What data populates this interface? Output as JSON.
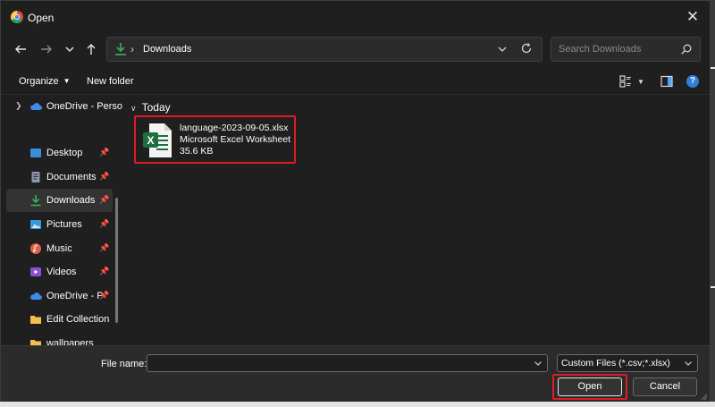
{
  "window": {
    "title": "Open",
    "close_glyph": "✕"
  },
  "nav_buttons": [
    "back-arrow-icon",
    "forward-arrow-icon",
    "recent-chevron-icon",
    "up-arrow-icon"
  ],
  "address": {
    "separator": "›",
    "path": "Downloads",
    "icon": "downloads-icon"
  },
  "search": {
    "placeholder": "Search Downloads"
  },
  "toolbar": {
    "organize_label": "Organize",
    "new_folder_label": "New folder",
    "help_glyph": "?"
  },
  "sidebar": {
    "items": [
      {
        "label": "OneDrive - Perso",
        "icon": "onedrive-icon",
        "expandable": true
      },
      {
        "label": "Desktop",
        "icon": "desktop-icon",
        "pinned": true
      },
      {
        "label": "Documents",
        "icon": "documents-icon",
        "pinned": true
      },
      {
        "label": "Downloads",
        "icon": "downloads-icon",
        "pinned": true,
        "selected": true
      },
      {
        "label": "Pictures",
        "icon": "pictures-icon",
        "pinned": true
      },
      {
        "label": "Music",
        "icon": "music-icon",
        "pinned": true
      },
      {
        "label": "Videos",
        "icon": "videos-icon",
        "pinned": true
      },
      {
        "label": "OneDrive - P",
        "icon": "onedrive-icon",
        "pinned": true
      },
      {
        "label": "Edit Collection",
        "icon": "folder-icon"
      },
      {
        "label": "wallpapers",
        "icon": "folder-icon"
      }
    ]
  },
  "content": {
    "group_label": "Today",
    "file": {
      "name": "language-2023-09-05.xlsx",
      "type": "Microsoft Excel Worksheet",
      "size": "35.6 KB",
      "icon": "excel-file-icon"
    }
  },
  "footer": {
    "file_name_label": "File name:",
    "file_name_value": "",
    "filter_label": "Custom Files (*.csv;*.xlsx)",
    "open_label": "Open",
    "cancel_label": "Cancel"
  },
  "colors": {
    "highlight": "#e01b24",
    "excel_green": "#1d6f42",
    "dialog_bg": "#1f1f1f",
    "accent": "#2f7fd6"
  }
}
